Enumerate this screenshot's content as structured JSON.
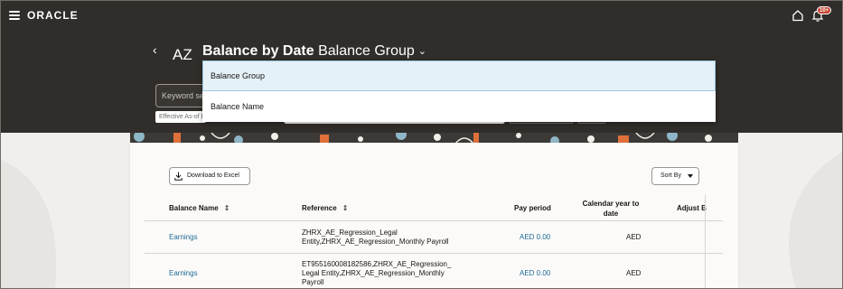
{
  "app": {
    "logo": "ORACLE",
    "notification_count": "10+"
  },
  "header": {
    "back_label": "‹",
    "initials": "AZ",
    "title_bold": "Balance by Date",
    "title_view": "Balance Group",
    "title_chevron": "⌄"
  },
  "filters": {
    "keyword_placeholder": "Keyword search",
    "effective_label": "Effective As-of Date"
  },
  "dropdown": {
    "options": [
      {
        "label": "Balance Group",
        "selected": true
      },
      {
        "label": "Balance Name",
        "selected": false
      }
    ]
  },
  "toolbar": {
    "download_label": "Download to Excel",
    "sortby_label": "Sort By"
  },
  "table": {
    "columns": [
      "Balance Name",
      "Reference",
      "Pay period",
      "Calendar year to date",
      "Adjust B"
    ],
    "rows": [
      {
        "balance_name": "Earnings",
        "reference_line1": "ZHRX_AE_Regression_Legal",
        "reference_line2": "Entity,ZHRX_AE_Regression_Monthly Payroll",
        "reference_line3": "",
        "pay_period": "AED 0.00",
        "ytd": "AED"
      },
      {
        "balance_name": "Earnings",
        "reference_line1": "ET955160008182586,ZHRX_AE_Regression_",
        "reference_line2": "Legal Entity,ZHRX_AE_Regression_Monthly",
        "reference_line3": "Payroll",
        "pay_period": "AED 0.00",
        "ytd": "AED"
      }
    ]
  },
  "colors": {
    "header_bg": "#312d2a",
    "link": "#1f6b97",
    "badge": "#c74634",
    "dropdown_highlight": "#e4f1f7"
  }
}
